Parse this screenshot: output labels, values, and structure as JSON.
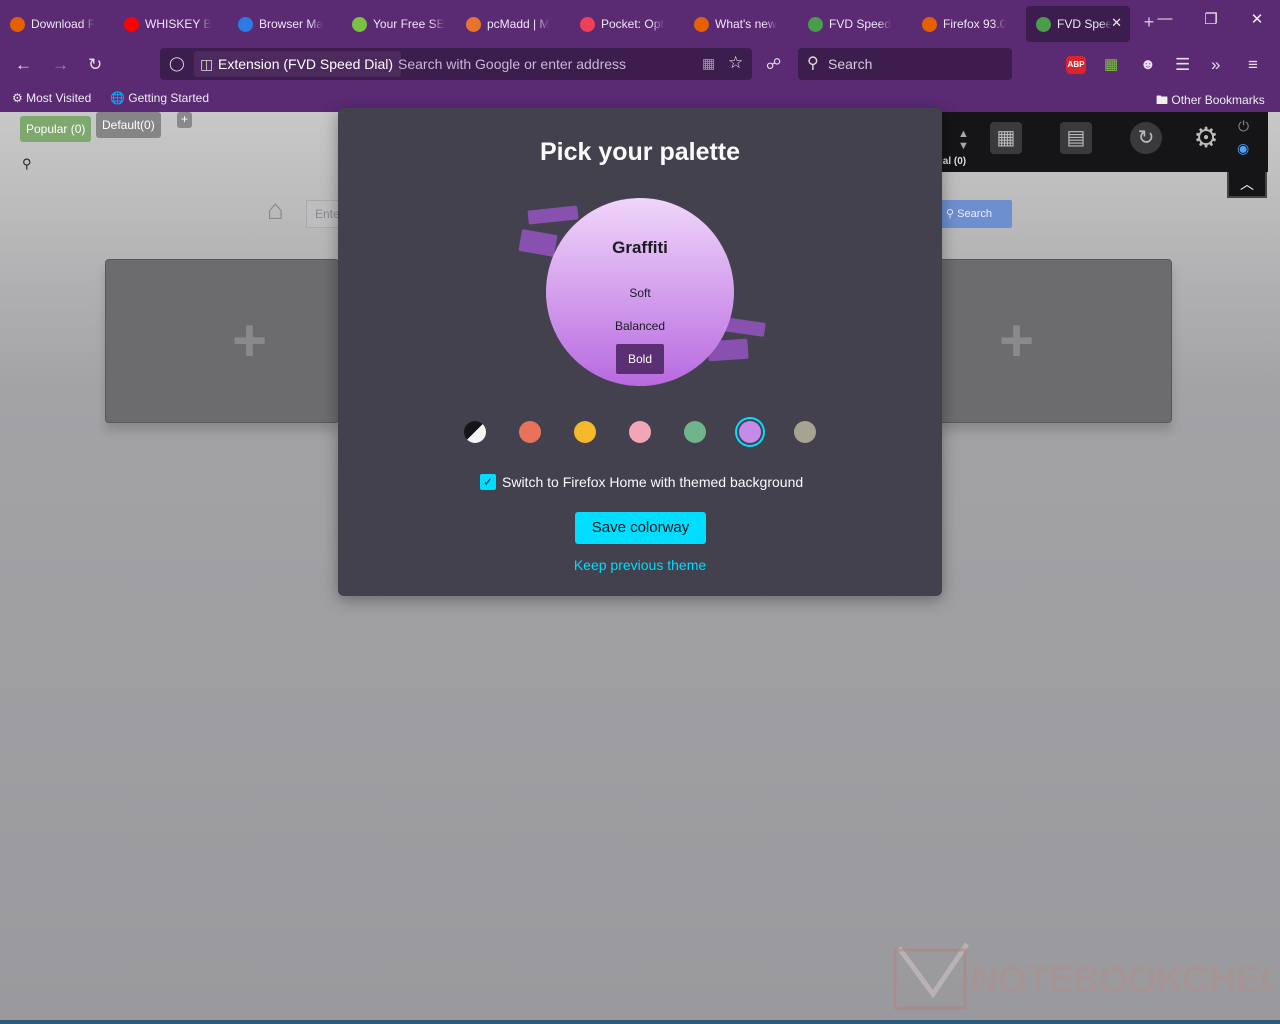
{
  "tabs": [
    {
      "title": "Download F",
      "icon": "firefox-icon",
      "color": "#e66000"
    },
    {
      "title": "WHISKEY B",
      "icon": "youtube-icon",
      "color": "#ff0000"
    },
    {
      "title": "Browser Ma",
      "icon": "browser-icon",
      "color": "#2c7be5"
    },
    {
      "title": "Your Free SE",
      "icon": "leaf-icon",
      "color": "#7cc242"
    },
    {
      "title": "pcMadd | M",
      "icon": "at-icon",
      "color": "#e8732a"
    },
    {
      "title": "Pocket: Opt",
      "icon": "pocket-icon",
      "color": "#ef4056"
    },
    {
      "title": "What's new",
      "icon": "firefox-icon",
      "color": "#e66000"
    },
    {
      "title": "FVD Speed",
      "icon": "speed-dial-icon",
      "color": "#4a9d4a"
    },
    {
      "title": "Firefox 93.0",
      "icon": "firefox-icon",
      "color": "#e66000"
    },
    {
      "title": "FVD Spee",
      "icon": "speed-dial-icon",
      "color": "#4a9d4a",
      "active": true
    }
  ],
  "navbar": {
    "identity_label": "Extension (FVD Speed Dial)",
    "url_placeholder": "Search with Google or enter address",
    "search_placeholder": "Search"
  },
  "bookmarks": {
    "most_visited": "Most Visited",
    "getting_started": "Getting Started",
    "other": "Other Bookmarks"
  },
  "speed_dial": {
    "groups": [
      "Popular (0)",
      "Default(0)"
    ],
    "add_group": "+",
    "search_placeholder": "Ente",
    "search_button": "Search",
    "toolbar_label": "ial (0)"
  },
  "modal": {
    "title": "Pick your palette",
    "colorway_name": "Graffiti",
    "variations": [
      "Soft",
      "Balanced",
      "Bold"
    ],
    "selected_variation": "Bold",
    "swatches": [
      "#f5f5f7",
      "#e8735a",
      "#f5b82a",
      "#f2a5b5",
      "#6fb48a",
      "#c48ce8",
      "#a8a293"
    ],
    "selected_swatch_index": 5,
    "checkbox_label": "Switch to Firefox Home with themed background",
    "checkbox_checked": true,
    "save_button": "Save colorway",
    "keep_link": "Keep previous theme"
  },
  "watermark": "NOTEBOOKCHECK",
  "colors": {
    "accent": "#00ddff",
    "toolbar": "#5a2a73",
    "modal_bg": "#42414d"
  }
}
